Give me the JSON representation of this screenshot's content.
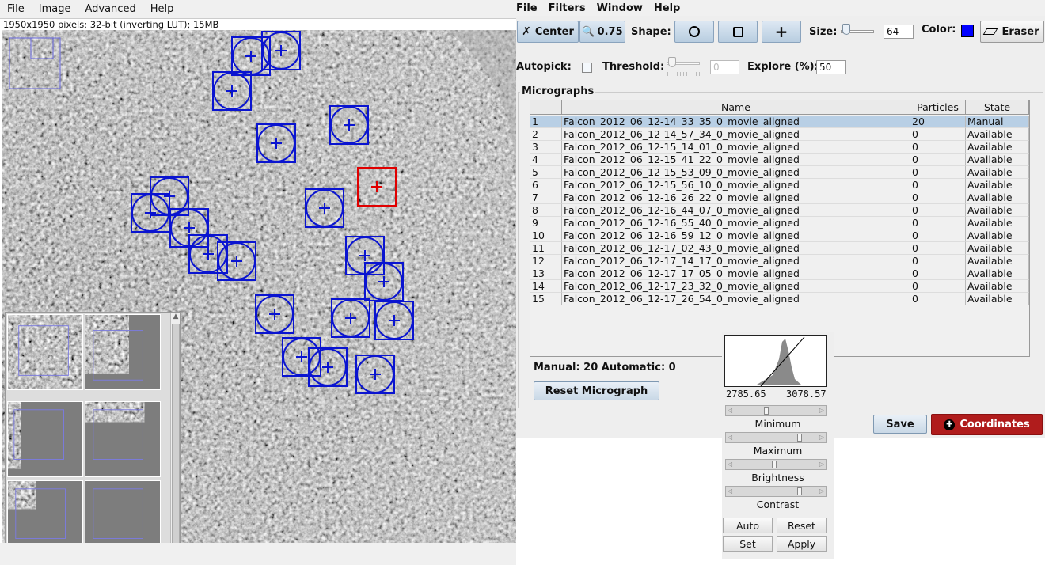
{
  "image_window": {
    "menu": [
      "File",
      "Image",
      "Advanced",
      "Help"
    ],
    "info": "1950x1950 pixels; 32-bit (inverting LUT); 15MB"
  },
  "picker": {
    "menu": [
      "File",
      "Filters",
      "Window",
      "Help"
    ],
    "toolbar": {
      "center_label": "Center",
      "zoom_value": "0.75",
      "shape_label": "Shape:",
      "size_label": "Size:",
      "size_value": "64",
      "color_label": "Color:",
      "color_value": "#0000ff",
      "eraser_label": "Eraser"
    },
    "autopick": {
      "label": "Autopick:",
      "threshold_label": "Threshold:",
      "threshold_value": "0",
      "explore_label": "Explore (%):",
      "explore_value": "50"
    },
    "micrographs": {
      "title": "Micrographs",
      "columns": [
        "Name",
        "Particles",
        "State"
      ],
      "rows": [
        {
          "n": "1",
          "name": "Falcon_2012_06_12-14_33_35_0_movie_aligned",
          "particles": "20",
          "state": "Manual"
        },
        {
          "n": "2",
          "name": "Falcon_2012_06_12-14_57_34_0_movie_aligned",
          "particles": "0",
          "state": "Available"
        },
        {
          "n": "3",
          "name": "Falcon_2012_06_12-15_14_01_0_movie_aligned",
          "particles": "0",
          "state": "Available"
        },
        {
          "n": "4",
          "name": "Falcon_2012_06_12-15_41_22_0_movie_aligned",
          "particles": "0",
          "state": "Available"
        },
        {
          "n": "5",
          "name": "Falcon_2012_06_12-15_53_09_0_movie_aligned",
          "particles": "0",
          "state": "Available"
        },
        {
          "n": "6",
          "name": "Falcon_2012_06_12-15_56_10_0_movie_aligned",
          "particles": "0",
          "state": "Available"
        },
        {
          "n": "7",
          "name": "Falcon_2012_06_12-16_26_22_0_movie_aligned",
          "particles": "0",
          "state": "Available"
        },
        {
          "n": "8",
          "name": "Falcon_2012_06_12-16_44_07_0_movie_aligned",
          "particles": "0",
          "state": "Available"
        },
        {
          "n": "9",
          "name": "Falcon_2012_06_12-16_55_40_0_movie_aligned",
          "particles": "0",
          "state": "Available"
        },
        {
          "n": "10",
          "name": "Falcon_2012_06_12-16_59_12_0_movie_aligned",
          "particles": "0",
          "state": "Available"
        },
        {
          "n": "11",
          "name": "Falcon_2012_06_12-17_02_43_0_movie_aligned",
          "particles": "0",
          "state": "Available"
        },
        {
          "n": "12",
          "name": "Falcon_2012_06_12-17_14_17_0_movie_aligned",
          "particles": "0",
          "state": "Available"
        },
        {
          "n": "13",
          "name": "Falcon_2012_06_12-17_17_05_0_movie_aligned",
          "particles": "0",
          "state": "Available"
        },
        {
          "n": "14",
          "name": "Falcon_2012_06_12-17_23_32_0_movie_aligned",
          "particles": "0",
          "state": "Available"
        },
        {
          "n": "15",
          "name": "Falcon_2012_06_12-17_26_54_0_movie_aligned",
          "particles": "0",
          "state": "Available"
        }
      ]
    },
    "counts": "Manual: 20 Automatic: 0",
    "reset_label": "Reset Micrograph",
    "save_label": "Save",
    "coordinates_label": "Coordinates"
  },
  "bc_dialog": {
    "min_value": "2785.65",
    "max_value": "3078.57",
    "labels": [
      "Minimum",
      "Maximum",
      "Brightness",
      "Contrast"
    ],
    "buttons": [
      "Auto",
      "Reset",
      "Set",
      "Apply"
    ]
  }
}
